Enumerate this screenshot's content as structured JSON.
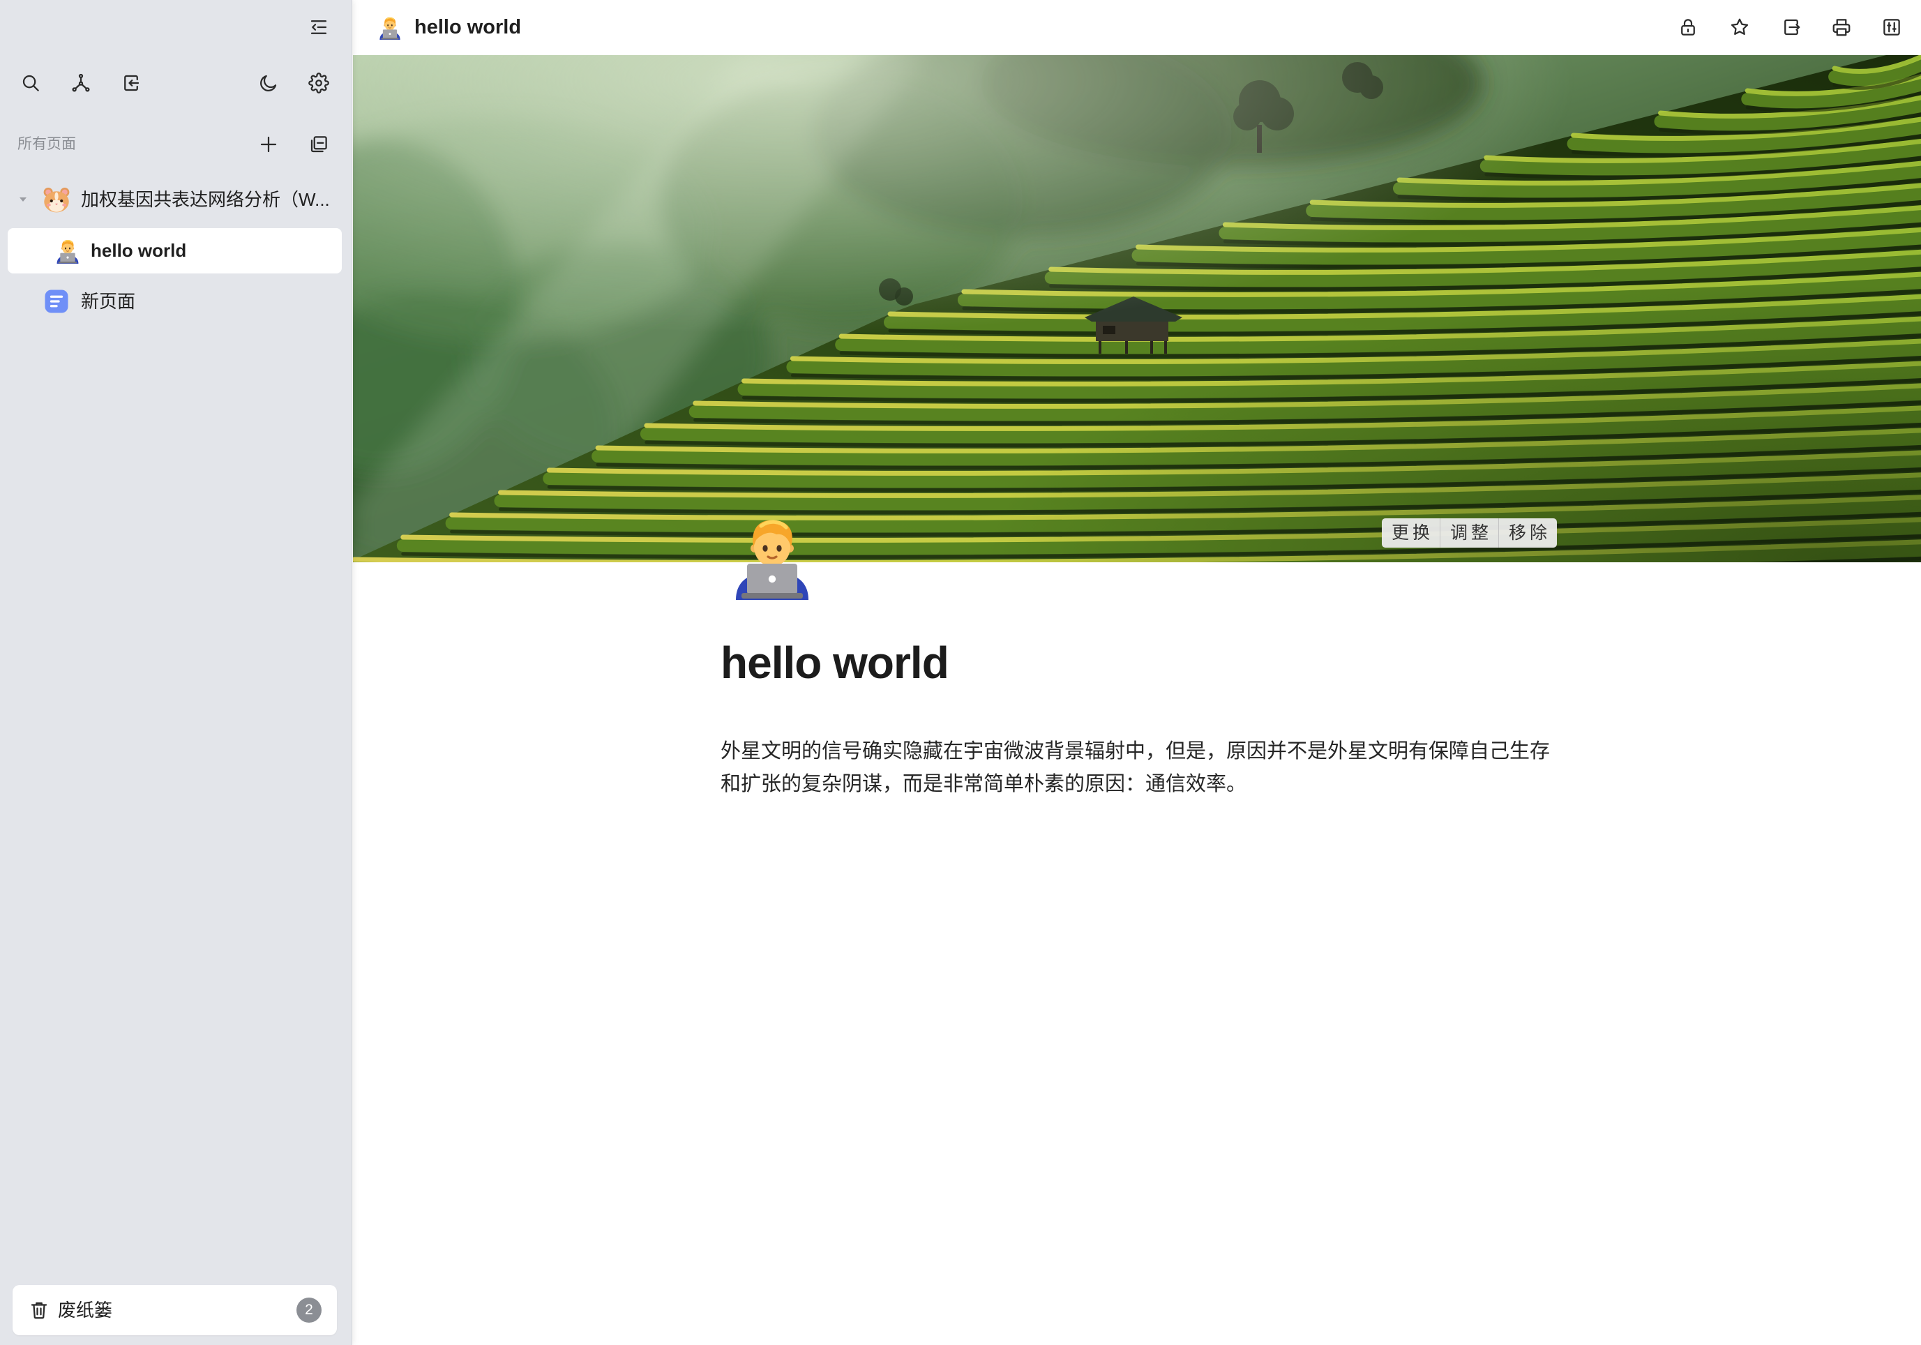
{
  "colors": {
    "sidebar_bg": "#e3e5ea",
    "selected_row_bg": "#ffffff",
    "text": "#1f1f1f",
    "muted_text": "#8a8d93",
    "doc_icon": "#6f8ff7",
    "badge_bg": "#8b8e94"
  },
  "sidebar": {
    "collapse_icon": "sidebar-collapse-icon",
    "toolbar": [
      "search-icon",
      "graph-icon",
      "import-icon",
      "moon-icon",
      "gear-icon"
    ],
    "section": {
      "label": "所有页面",
      "add_icon": "plus-icon",
      "collapse_all_icon": "collapse-all-icon"
    },
    "tree": [
      {
        "label": "加权基因共表达网络分析（W...",
        "icon": "hamster-icon",
        "expanded": true,
        "selected": false
      },
      {
        "label": "hello world",
        "icon": "technologist-icon",
        "selected": true
      },
      {
        "label": "新页面",
        "icon": "document-icon",
        "selected": false
      }
    ],
    "trash": {
      "label": "废纸篓",
      "icon": "trash-icon",
      "count": 2
    }
  },
  "header": {
    "icon": "technologist-icon",
    "title": "hello world",
    "actions": [
      "lock-icon",
      "star-icon",
      "export-icon",
      "printer-icon",
      "sliders-icon"
    ]
  },
  "cover": {
    "buttons": [
      "更换",
      "调整",
      "移除"
    ]
  },
  "page": {
    "icon": "technologist-icon",
    "title": "hello world",
    "paragraphs": [
      "外星文明的信号确实隐藏在宇宙微波背景辐射中，但是，原因并不是外星文明有保障自己生存和扩张的复杂阴谋，而是非常简单朴素的原因：通信效率。"
    ]
  }
}
